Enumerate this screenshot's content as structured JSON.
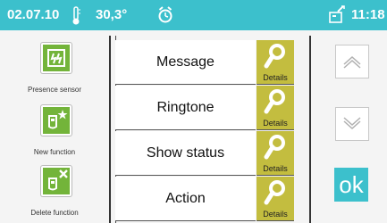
{
  "status": {
    "date": "02.07.10",
    "temperature": "30,3°",
    "time": "11:18",
    "thermometer_icon": "thermometer-icon",
    "alarm_icon": "alarm-clock-icon",
    "phone_icon": "phone-icon",
    "bar_color": "#3cc0cc"
  },
  "left_actions": [
    {
      "label": "Presence sensor",
      "icon": "presence-sensor-icon"
    },
    {
      "label": "New function",
      "icon": "new-function-icon"
    },
    {
      "label": "Delete function",
      "icon": "delete-function-icon"
    }
  ],
  "menu_items": [
    {
      "label": "Message",
      "details": "Details"
    },
    {
      "label": "Ringtone",
      "details": "Details"
    },
    {
      "label": "Show status",
      "details": "Details"
    },
    {
      "label": "Action",
      "details": "Details"
    }
  ],
  "controls": {
    "up_icon": "chevron-up-icon",
    "down_icon": "chevron-down-icon",
    "ok_label": "ok"
  },
  "colors": {
    "accent": "#3cc0cc",
    "details": "#c3bd3f",
    "icon_green": "#73b43a"
  }
}
